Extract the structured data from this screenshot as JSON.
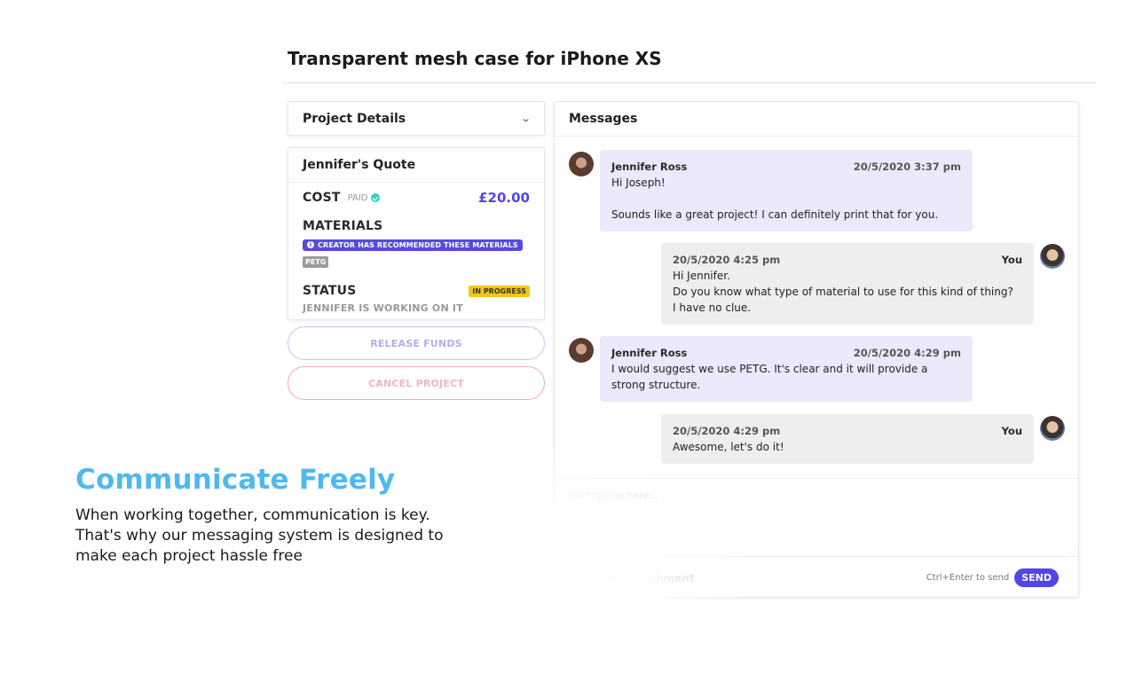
{
  "page": {
    "title": "Transparent mesh case for iPhone XS"
  },
  "project_details": {
    "label": "Project Details",
    "chevron_icon": "chevron-down-icon"
  },
  "quote": {
    "title": "Jennifer's Quote",
    "cost_label": "COST",
    "paid_label": "PAID",
    "price": "£20.00",
    "materials_label": "MATERIALS",
    "recommended_badge": "CREATOR HAS RECOMMENDED THESE MATERIALS",
    "material_tag": "PETG",
    "status_label": "STATUS",
    "status_badge": "IN PROGRESS",
    "status_text": "JENNIFER IS WORKING ON IT"
  },
  "actions": {
    "release_label": "RELEASE FUNDS",
    "cancel_label": "CANCEL PROJECT"
  },
  "messages": {
    "title": "Messages",
    "items": [
      {
        "author": "Jennifer Ross",
        "time": "20/5/2020 3:37 pm",
        "text": "Hi Joseph!\n\nSounds like a great project! I can definitely print that for you."
      },
      {
        "author": "You",
        "time": "20/5/2020 4:25 pm",
        "text": "Hi Jennifer.\nDo you know what type of material to use for this kind of thing?\nI have no clue."
      },
      {
        "author": "Jennifer Ross",
        "time": "20/5/2020 4:29 pm",
        "text": "I would suggest we use PETG. It's clear and it will provide a\nstrong structure."
      },
      {
        "author": "You",
        "time": "20/5/2020 4:29 pm",
        "text": "Awesome, let's do it!"
      }
    ],
    "input_placeholder": "Start typing here...",
    "attach_label": "Send Attachment",
    "hint": "Ctrl+Enter to send",
    "send_label": "SEND"
  },
  "marketing": {
    "title": "Communicate Freely",
    "body": "When working together, communication is key. That's why our messaging system is designed to make each project hassle free"
  },
  "colors": {
    "accent": "#5146e8",
    "marketing_title": "#4fb9ef",
    "status_badge": "#f5c518",
    "paid_check": "#2ed1c4"
  }
}
